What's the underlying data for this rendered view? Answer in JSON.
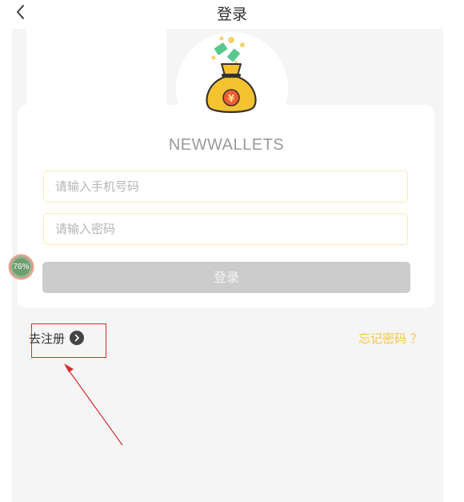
{
  "header": {
    "back_icon": "chevron-left-icon",
    "title": "登录"
  },
  "logo": {
    "icon": "money-bag-icon"
  },
  "brand": "NEWWALLETS",
  "form": {
    "phone_placeholder": "请输入手机号码",
    "password_placeholder": "请输入密码",
    "login_label": "登录"
  },
  "overlay_progress": {
    "value_percent": 76,
    "label": "76%"
  },
  "links": {
    "register_label": "去注册",
    "register_icon": "chevron-right-circle-icon",
    "forgot_label": "忘记密码 ？"
  },
  "colors": {
    "accent": "#f4c544",
    "input_border": "#fbe9b8",
    "button_disabled": "#cccccc",
    "annotation_red": "#d62c2c"
  }
}
